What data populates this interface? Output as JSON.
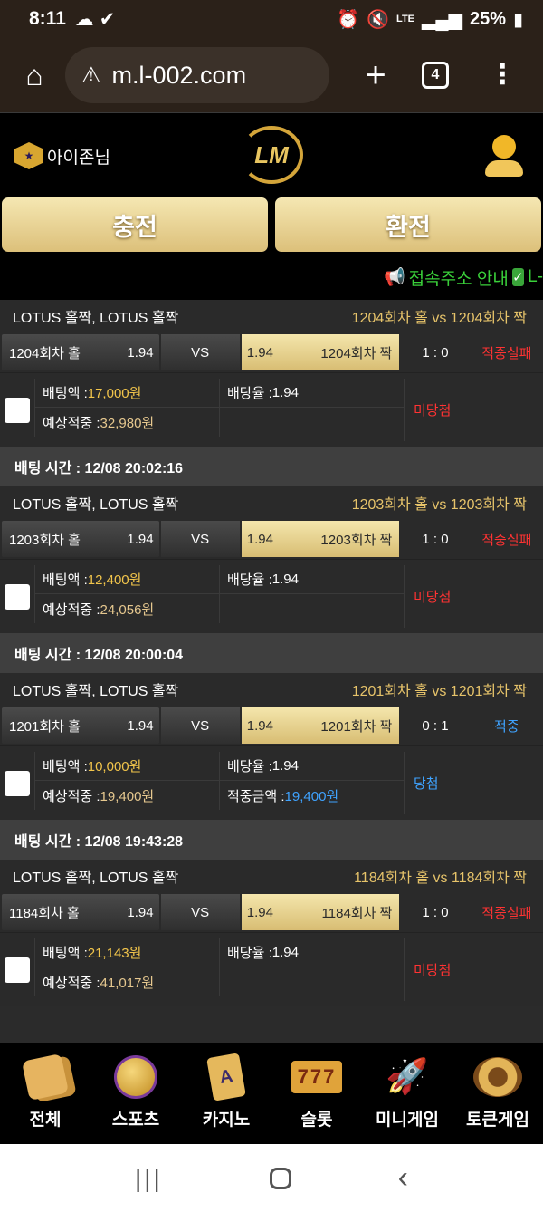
{
  "status_bar": {
    "time": "8:11",
    "battery": "25%",
    "network": "LTE"
  },
  "browser": {
    "url": "m.l-002.com",
    "tab_count": "4"
  },
  "header": {
    "username": "아이존님",
    "logo_text": "LM"
  },
  "actions": {
    "deposit": "충전",
    "withdraw": "환전"
  },
  "notice": {
    "text": "접속주소 안내",
    "tail": "L-"
  },
  "bets": [
    {
      "time_label": "",
      "title": "LOTUS 홀짝, LOTUS 홀짝",
      "match": "1204회차 홀  vs  1204회차 짝",
      "home_name": "1204회차 홀",
      "home_odds": "1.94",
      "vs": "VS",
      "away_odds": "1.94",
      "away_name": "1204회차 짝",
      "score": "1 : 0",
      "result": "적중실패",
      "result_color": "red",
      "bet_amount_label": "배팅액 : ",
      "bet_amount": "17,000원",
      "odds_label": "배당율 : ",
      "odds": "1.94",
      "expected_label": "예상적중 : ",
      "expected": "32,980원",
      "win_label": "",
      "win_amount": "",
      "status": "미당첨",
      "status_color": "red"
    },
    {
      "time_label": "배팅 시간 : 12/08 20:02:16",
      "title": "LOTUS 홀짝, LOTUS 홀짝",
      "match": "1203회차 홀  vs  1203회차 짝",
      "home_name": "1203회차 홀",
      "home_odds": "1.94",
      "vs": "VS",
      "away_odds": "1.94",
      "away_name": "1203회차 짝",
      "score": "1 : 0",
      "result": "적중실패",
      "result_color": "red",
      "bet_amount_label": "배팅액 : ",
      "bet_amount": "12,400원",
      "odds_label": "배당율 : ",
      "odds": "1.94",
      "expected_label": "예상적중 : ",
      "expected": "24,056원",
      "win_label": "",
      "win_amount": "",
      "status": "미당첨",
      "status_color": "red"
    },
    {
      "time_label": "배팅 시간 : 12/08 20:00:04",
      "title": "LOTUS 홀짝, LOTUS 홀짝",
      "match": "1201회차 홀  vs  1201회차 짝",
      "home_name": "1201회차 홀",
      "home_odds": "1.94",
      "vs": "VS",
      "away_odds": "1.94",
      "away_name": "1201회차 짝",
      "score": "0 : 1",
      "result": "적중",
      "result_color": "blue",
      "bet_amount_label": "배팅액 : ",
      "bet_amount": "10,000원",
      "odds_label": "배당율 : ",
      "odds": "1.94",
      "expected_label": "예상적중 : ",
      "expected": "19,400원",
      "win_label": "적중금액 : ",
      "win_amount": "19,400원",
      "status": "당첨",
      "status_color": "blue"
    },
    {
      "time_label": "배팅 시간 : 12/08 19:43:28",
      "title": "LOTUS 홀짝, LOTUS 홀짝",
      "match": "1184회차 홀  vs  1184회차 짝",
      "home_name": "1184회차 홀",
      "home_odds": "1.94",
      "vs": "VS",
      "away_odds": "1.94",
      "away_name": "1184회차 짝",
      "score": "1 : 0",
      "result": "적중실패",
      "result_color": "red",
      "bet_amount_label": "배팅액 : ",
      "bet_amount": "21,143원",
      "odds_label": "배당율 : ",
      "odds": "1.94",
      "expected_label": "예상적중 : ",
      "expected": "41,017원",
      "win_label": "",
      "win_amount": "",
      "status": "미당첨",
      "status_color": "red"
    }
  ],
  "bottom_nav": [
    {
      "label": "전체",
      "icon": "dice-icon"
    },
    {
      "label": "스포츠",
      "icon": "ball-icon"
    },
    {
      "label": "카지노",
      "icon": "card-icon"
    },
    {
      "label": "슬롯",
      "icon": "slot-777-icon"
    },
    {
      "label": "미니게임",
      "icon": "rocket-icon"
    },
    {
      "label": "토큰게임",
      "icon": "roulette-icon"
    }
  ]
}
